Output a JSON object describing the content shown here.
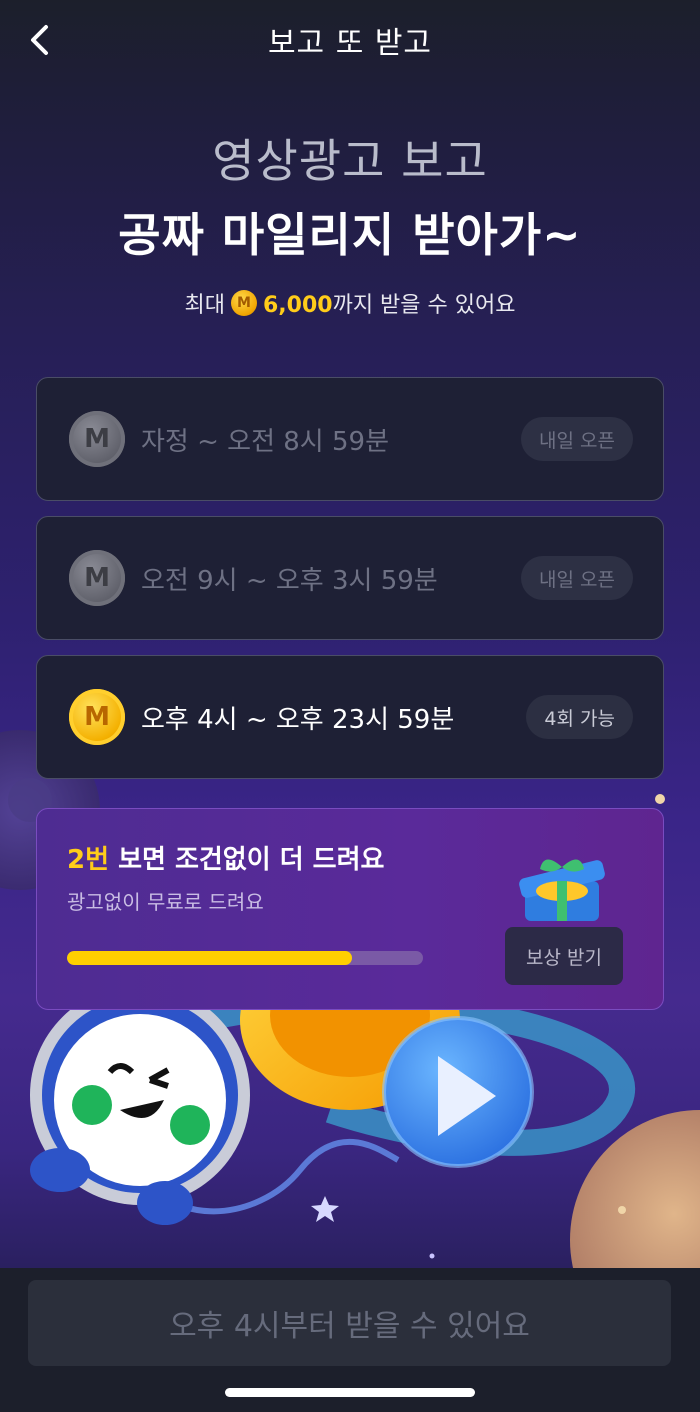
{
  "header": {
    "title": "보고 또 받고"
  },
  "hero": {
    "subtitle": "영상광고 보고",
    "headline": "공짜 마일리지 받아가~",
    "note_prefix": "최대",
    "coin_letter": "M",
    "note_amount": "6,000",
    "note_suffix": "까지 받을 수 있어요"
  },
  "slots": [
    {
      "coin_letter": "M",
      "time": "자정 ~ 오전 8시 59분",
      "badge": "내일 오픈",
      "state": "closed"
    },
    {
      "coin_letter": "M",
      "time": "오전 9시 ~ 오후 3시 59분",
      "badge": "내일 오픈",
      "state": "closed"
    },
    {
      "coin_letter": "M",
      "time": "오후 4시 ~ 오후 23시 59분",
      "badge": "4회 가능",
      "state": "active"
    }
  ],
  "bonus": {
    "title_highlight": "2번",
    "title_rest": " 보면 조건없이 더 드려요",
    "description": "광고없이 무료로 드려요",
    "progress": 0.8,
    "reward_button": "보상 받기"
  },
  "cta": {
    "label": "오후 4시부터 받을 수 있어요"
  },
  "colors": {
    "accent_gold": "#ffcc1a",
    "bonus_purple": "#5a2a9a",
    "background": "#15182a"
  }
}
